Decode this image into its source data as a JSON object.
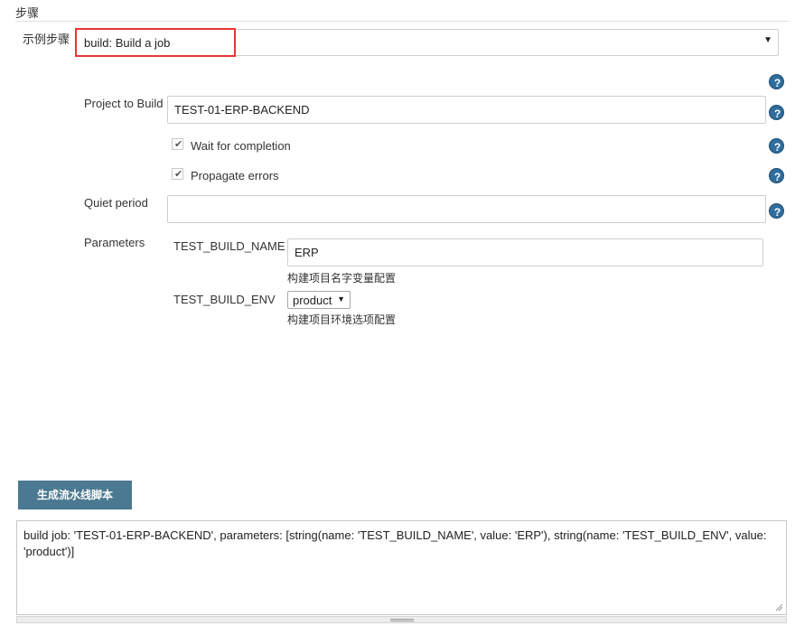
{
  "section": {
    "title": "步骤"
  },
  "step": {
    "label": "示例步骤",
    "selected": "build: Build a job"
  },
  "fields": {
    "project_label": "Project to Build",
    "project_value": "TEST-01-ERP-BACKEND",
    "wait_label": "Wait for completion",
    "wait_checked": true,
    "propagate_label": "Propagate errors",
    "propagate_checked": true,
    "quiet_label": "Quiet period",
    "quiet_value": "",
    "parameters_label": "Parameters"
  },
  "parameters": [
    {
      "name": "TEST_BUILD_NAME",
      "value": "ERP",
      "description": "构建项目名字变量配置"
    },
    {
      "name": "TEST_BUILD_ENV",
      "value": "product",
      "description": "构建项目环境选项配置"
    }
  ],
  "generate_button": "生成流水线脚本",
  "output": "build job: 'TEST-01-ERP-BACKEND', parameters: [string(name: 'TEST_BUILD_NAME', value: 'ERP'), string(name: 'TEST_BUILD_ENV', value: 'product')]",
  "colors": {
    "button_bg": "#4a7991",
    "highlight": "#e53935",
    "help_icon": "#2e6e9e"
  },
  "icons": {
    "help": "help-icon",
    "dropdown": "chevron-down-icon",
    "check": "checkmark-icon"
  }
}
